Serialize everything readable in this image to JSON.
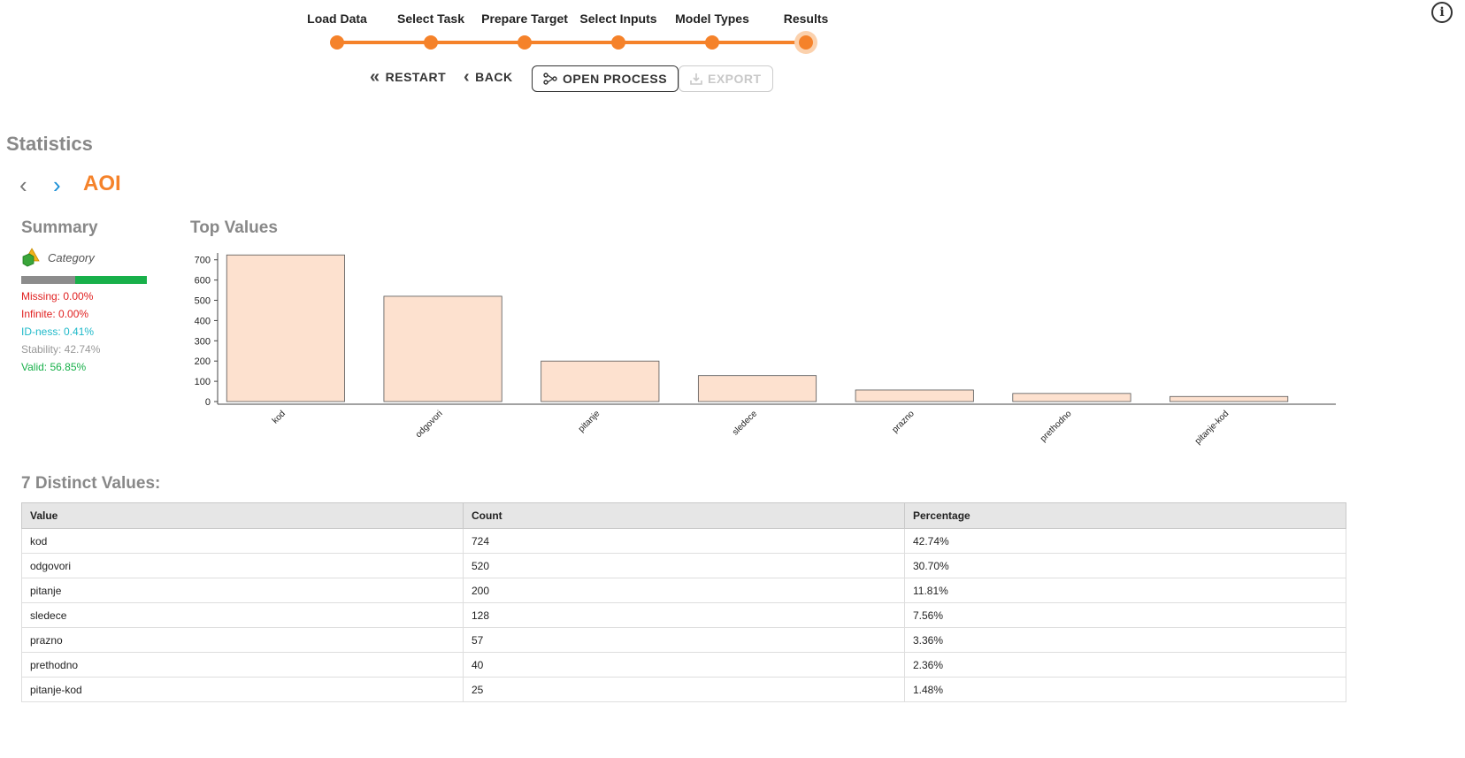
{
  "wizard": {
    "steps": [
      "Load Data",
      "Select Task",
      "Prepare Target",
      "Select Inputs",
      "Model Types",
      "Results"
    ],
    "controls": {
      "restart": "RESTART",
      "back": "BACK",
      "open_process": "OPEN PROCESS",
      "export": "EXPORT"
    },
    "accent_color": "#f5822a"
  },
  "info_icon": "info-icon",
  "statistics": {
    "title": "Statistics",
    "attribute": "AOI",
    "summary": {
      "title": "Summary",
      "type_label": "Category",
      "quality_bar": {
        "gray_fraction": 0.4274,
        "green_fraction": 0.5685
      },
      "stats": [
        {
          "label": "Missing: 0.00%",
          "color": "#e02020"
        },
        {
          "label": "Infinite: 0.00%",
          "color": "#e02020"
        },
        {
          "label": "ID-ness: 0.41%",
          "color": "#1fb9c9"
        },
        {
          "label": "Stability: 42.74%",
          "color": "#999999"
        },
        {
          "label": "Valid: 56.85%",
          "color": "#18b04a"
        }
      ]
    },
    "top_values_title": "Top Values",
    "distinct_title": "7 Distinct Values:",
    "table": {
      "headers": [
        "Value",
        "Count",
        "Percentage"
      ],
      "rows": [
        [
          "kod",
          "724",
          "42.74%"
        ],
        [
          "odgovori",
          "520",
          "30.70%"
        ],
        [
          "pitanje",
          "200",
          "11.81%"
        ],
        [
          "sledece",
          "128",
          "7.56%"
        ],
        [
          "prazno",
          "57",
          "3.36%"
        ],
        [
          "prethodno",
          "40",
          "2.36%"
        ],
        [
          "pitanje-kod",
          "25",
          "1.48%"
        ]
      ]
    }
  },
  "chart_data": {
    "type": "bar",
    "categories": [
      "kod",
      "odgovori",
      "pitanje",
      "sledece",
      "prazno",
      "prethodno",
      "pitanje-kod"
    ],
    "values": [
      724,
      520,
      200,
      128,
      57,
      40,
      25
    ],
    "title": "Top Values",
    "xlabel": "",
    "ylabel": "",
    "ylim": [
      0,
      760
    ],
    "yticks": [
      0,
      100,
      200,
      300,
      400,
      500,
      600,
      700
    ],
    "bar_color": "#fde1cf",
    "bar_border": "#555555",
    "grid": false
  }
}
